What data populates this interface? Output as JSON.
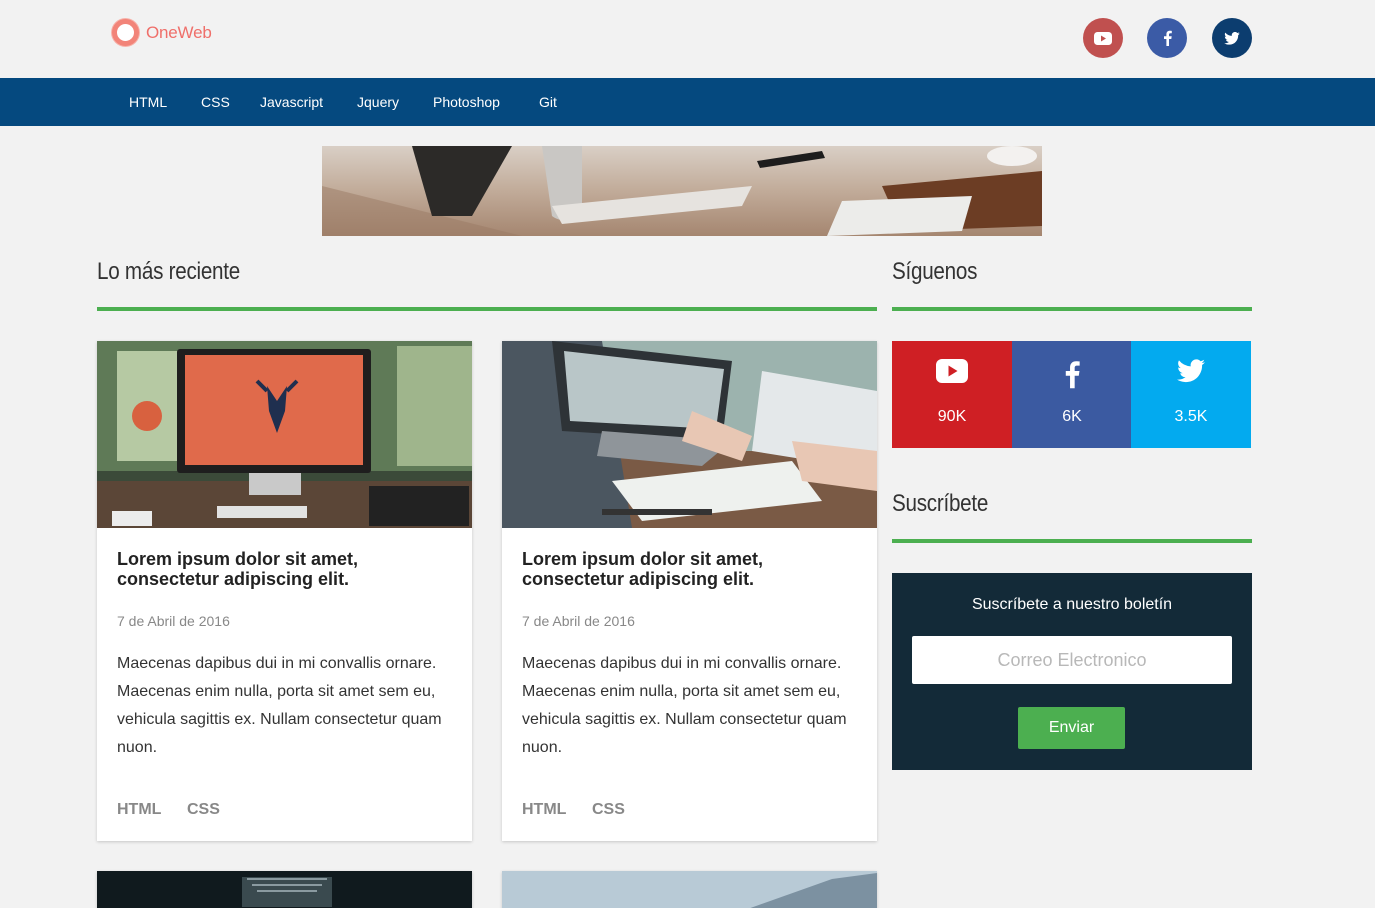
{
  "brand": {
    "name": "OneWeb",
    "color": "#ef6f6a"
  },
  "header_social": [
    {
      "icon": "youtube-icon",
      "color": "#c0504f"
    },
    {
      "icon": "facebook-icon",
      "color": "#3b5ba6"
    },
    {
      "icon": "twitter-icon",
      "color": "#0c3d6f"
    }
  ],
  "nav": {
    "color": "#05497f",
    "items": [
      "HTML",
      "CSS",
      "Javascript",
      "Jquery",
      "Photoshop",
      "Git"
    ]
  },
  "main": {
    "section_title": "Lo más reciente",
    "accent": "#4caf50",
    "posts": [
      {
        "title": "Lorem ipsum dolor sit amet, consectetur adipiscing elit.",
        "date": "7 de Abril de 2016",
        "excerpt": "Maecenas dapibus dui in mi convallis ornare. Maecenas enim nulla, porta sit amet sem eu, vehicula sagittis ex. Nullam consectetur quam nuon.",
        "tags": [
          "HTML",
          "CSS"
        ]
      },
      {
        "title": "Lorem ipsum dolor sit amet, consectetur adipiscing elit.",
        "date": "7 de Abril de 2016",
        "excerpt": "Maecenas dapibus dui in mi convallis ornare. Maecenas enim nulla, porta sit amet sem eu, vehicula sagittis ex. Nullam consectetur quam nuon.",
        "tags": [
          "HTML",
          "CSS"
        ]
      }
    ]
  },
  "sidebar": {
    "follow_title": "Síguenos",
    "follow": [
      {
        "icon": "youtube-icon",
        "count": "90K",
        "color": "#cf1f24"
      },
      {
        "icon": "facebook-icon",
        "count": "6K",
        "color": "#3b5aa1"
      },
      {
        "icon": "twitter-icon",
        "count": "3.5K",
        "color": "#03aaef"
      }
    ],
    "subscribe_title": "Suscríbete",
    "subscribe": {
      "label": "Suscríbete a nuestro boletín",
      "placeholder": "Correo Electronico",
      "button": "Enviar",
      "background": "#132a38"
    }
  }
}
